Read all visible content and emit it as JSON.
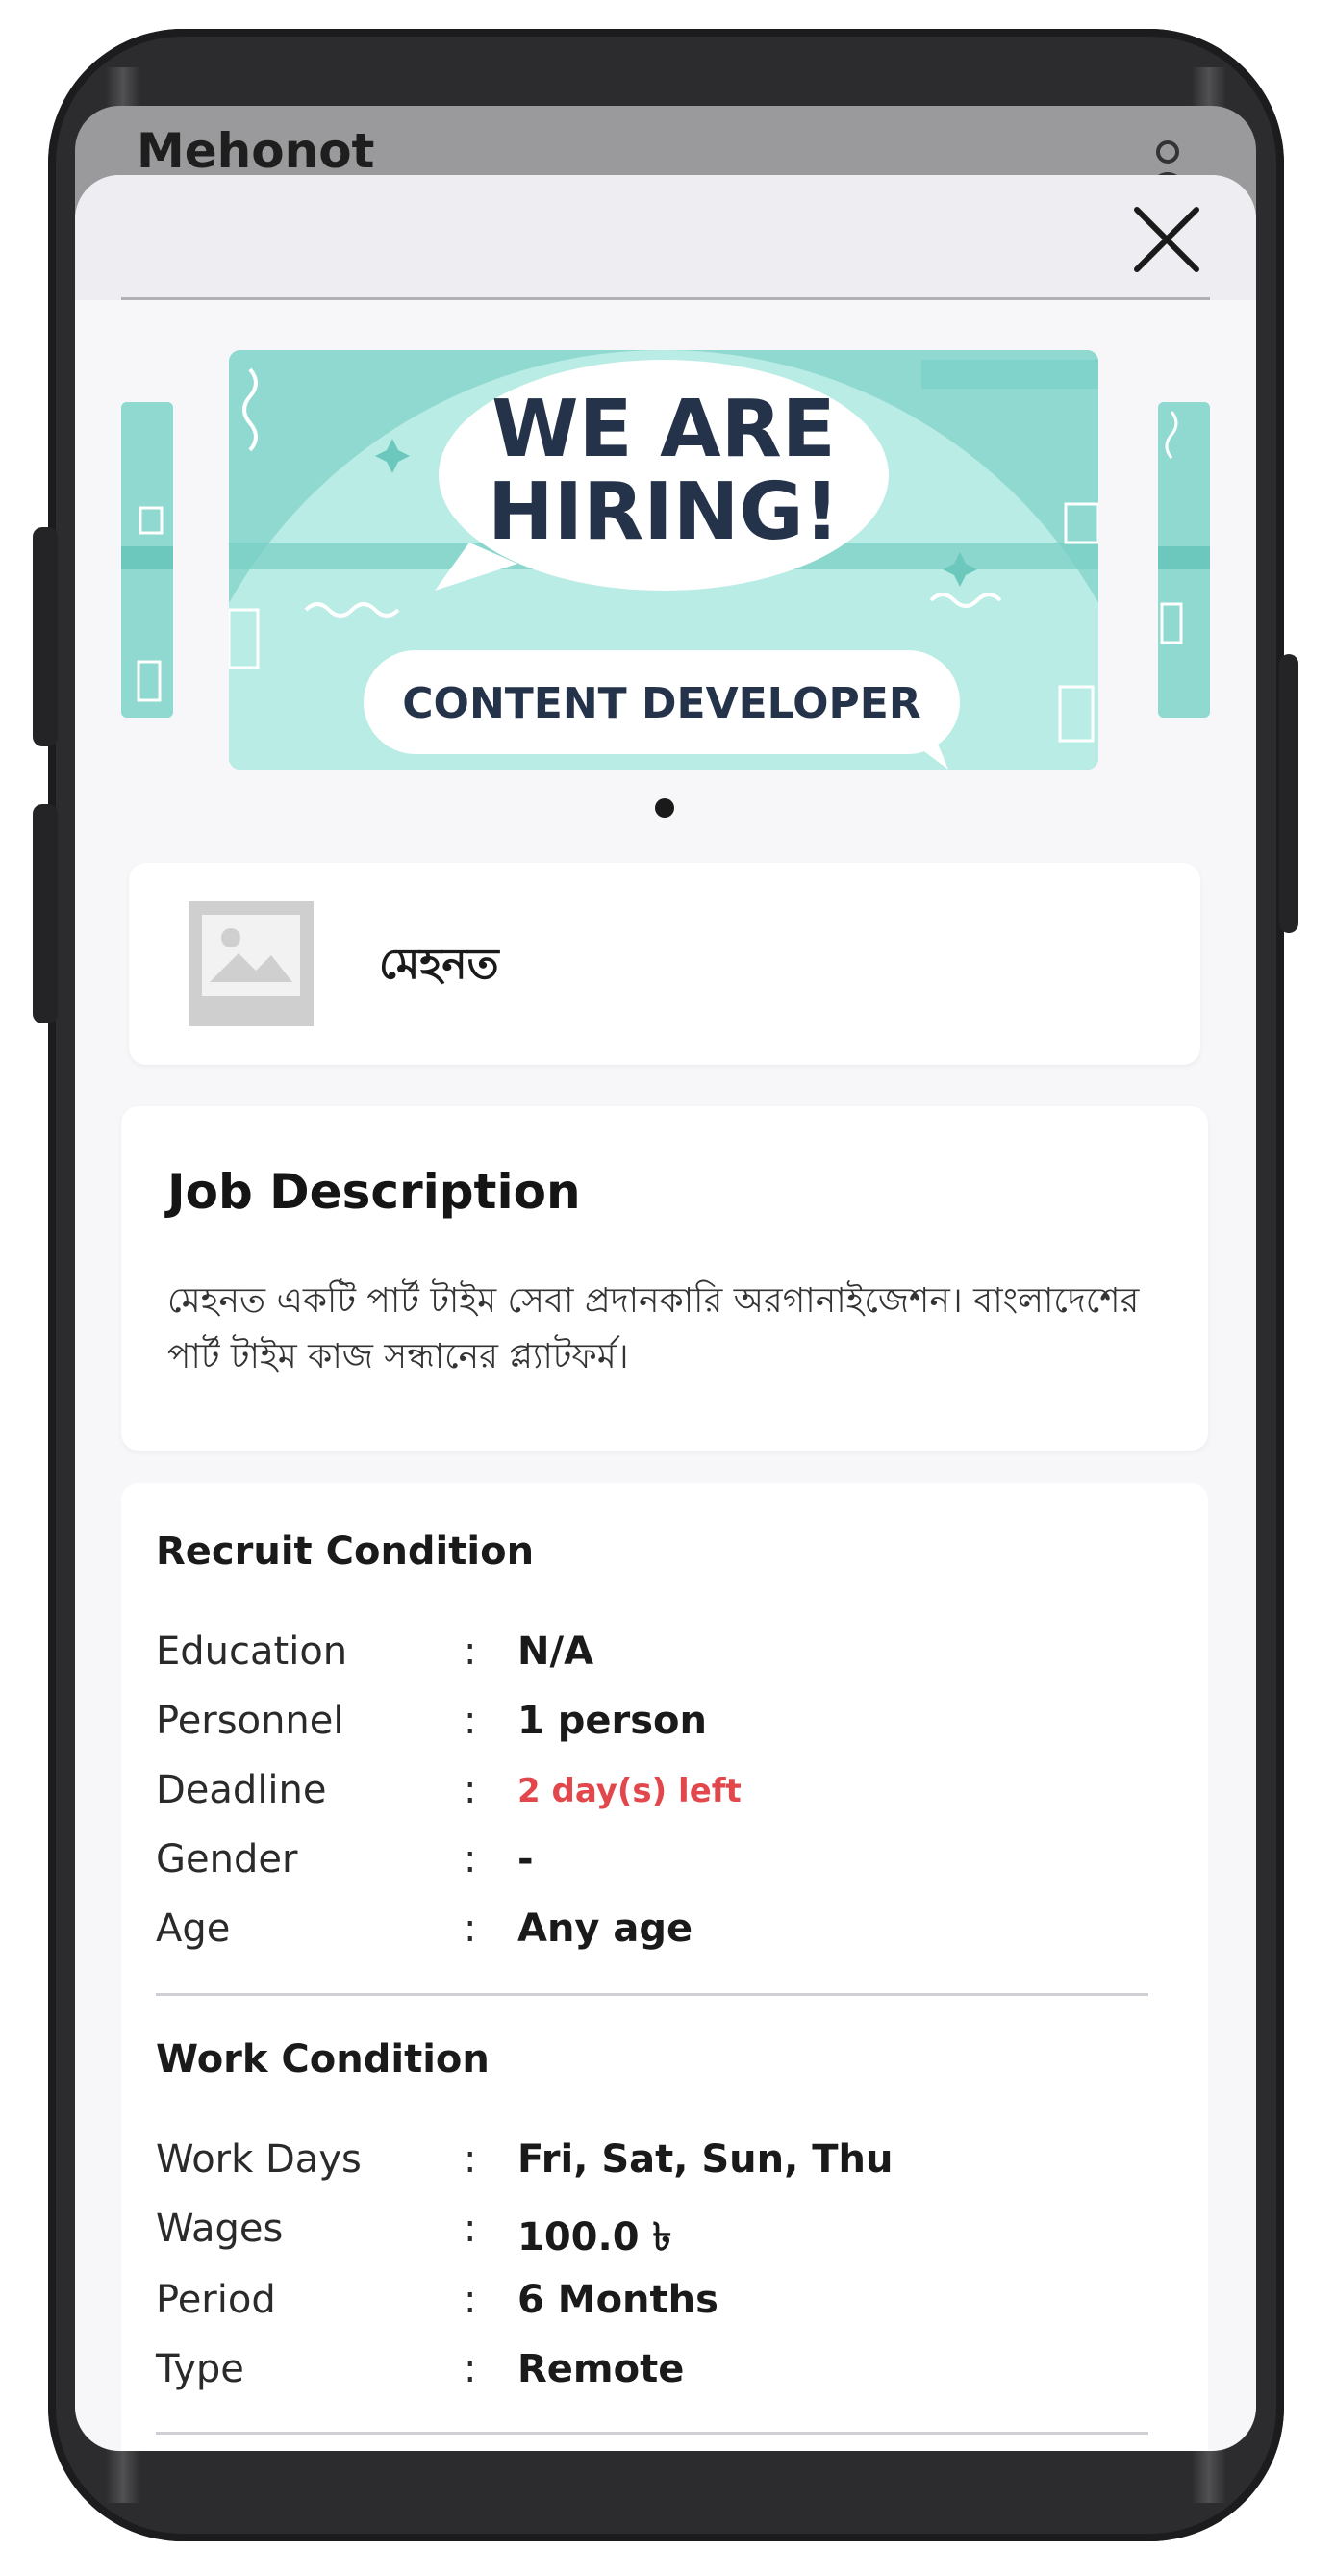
{
  "app": {
    "title": "Mehonot"
  },
  "banner": {
    "headline_line1": "WE ARE",
    "headline_line2": "HIRING!",
    "role": "CONTENT DEVELOPER",
    "colors": {
      "bg": "#8fd9d1",
      "circle": "#b9ece5",
      "text": "#24334a"
    }
  },
  "company": {
    "name": "মেহনত",
    "logo_icon": "image-placeholder-icon"
  },
  "job_description": {
    "title": "Job Description",
    "text": "মেহনত একটি পার্ট টাইম সেবা প্রদানকারি অরগানাইজেশন। বাংলাদেশের পার্ট টাইম কাজ সন্ধানের প্ল্যাটফর্ম।"
  },
  "recruit_condition": {
    "title": "Recruit Condition",
    "rows": [
      {
        "label": "Education",
        "value": "N/A"
      },
      {
        "label": "Personnel",
        "value": "1 person"
      },
      {
        "label": "Deadline",
        "value": "2 day(s) left"
      },
      {
        "label": "Gender",
        "value": "-"
      },
      {
        "label": "Age",
        "value": "Any age"
      }
    ]
  },
  "work_condition": {
    "title": "Work Condition",
    "rows": [
      {
        "label": "Work Days",
        "value": "Fri, Sat, Sun, Thu"
      },
      {
        "label": "Wages",
        "value": "100.0 ৳"
      },
      {
        "label": "Period",
        "value": "6 Months"
      },
      {
        "label": "Type",
        "value": "Remote"
      }
    ]
  },
  "separator": ":",
  "colors": {
    "deadline": "#e2474c"
  }
}
